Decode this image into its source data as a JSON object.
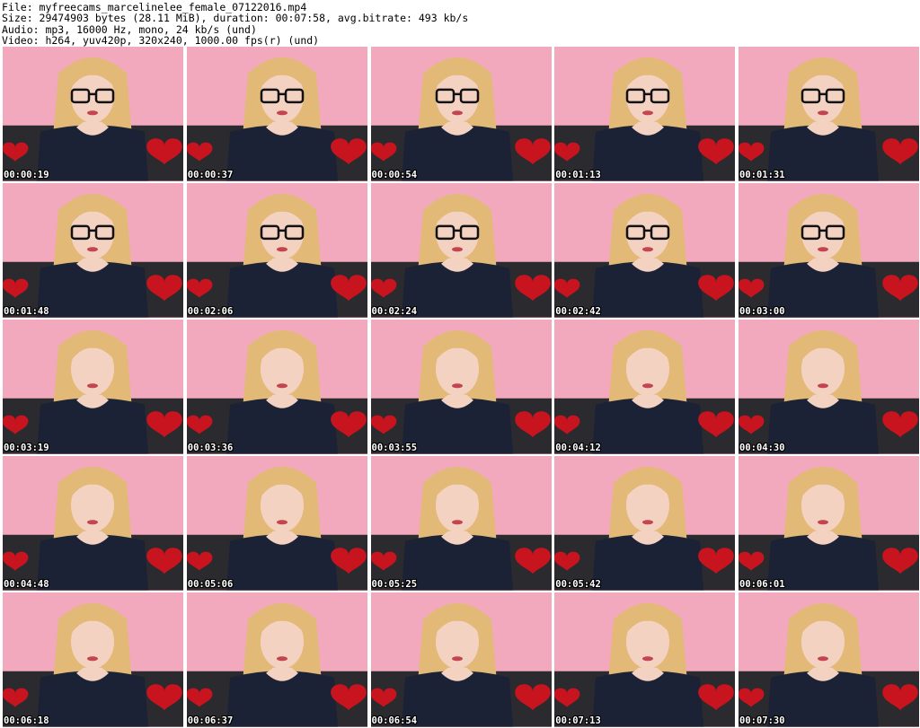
{
  "header": {
    "line1": "File: myfreecams_marcelinelee_female_07122016.mp4",
    "line2": "Size: 29474903 bytes (28.11 MiB), duration: 00:07:58, avg.bitrate: 493 kb/s",
    "line3": "Audio: mp3, 16000 Hz, mono, 24 kb/s (und)",
    "line4": "Video: h264, yuv420p, 320x240, 1000.00 fps(r) (und)"
  },
  "colors": {
    "background": "#f3a9bd",
    "hair": "#e3b978",
    "skin": "#f4d2c2",
    "dress": "#1b2236",
    "couch": "#2b2a2e",
    "heart": "#c8141e"
  },
  "thumbnails": [
    {
      "timestamp": "00:00:19",
      "glasses": true
    },
    {
      "timestamp": "00:00:37",
      "glasses": true
    },
    {
      "timestamp": "00:00:54",
      "glasses": true
    },
    {
      "timestamp": "00:01:13",
      "glasses": true
    },
    {
      "timestamp": "00:01:31",
      "glasses": true
    },
    {
      "timestamp": "00:01:48",
      "glasses": true
    },
    {
      "timestamp": "00:02:06",
      "glasses": true
    },
    {
      "timestamp": "00:02:24",
      "glasses": true
    },
    {
      "timestamp": "00:02:42",
      "glasses": true
    },
    {
      "timestamp": "00:03:00",
      "glasses": true
    },
    {
      "timestamp": "00:03:19",
      "glasses": false
    },
    {
      "timestamp": "00:03:36",
      "glasses": false
    },
    {
      "timestamp": "00:03:55",
      "glasses": false
    },
    {
      "timestamp": "00:04:12",
      "glasses": false
    },
    {
      "timestamp": "00:04:30",
      "glasses": false
    },
    {
      "timestamp": "00:04:48",
      "glasses": false
    },
    {
      "timestamp": "00:05:06",
      "glasses": false
    },
    {
      "timestamp": "00:05:25",
      "glasses": false
    },
    {
      "timestamp": "00:05:42",
      "glasses": false
    },
    {
      "timestamp": "00:06:01",
      "glasses": false
    },
    {
      "timestamp": "00:06:18",
      "glasses": false
    },
    {
      "timestamp": "00:06:37",
      "glasses": false
    },
    {
      "timestamp": "00:06:54",
      "glasses": false
    },
    {
      "timestamp": "00:07:13",
      "glasses": false
    },
    {
      "timestamp": "00:07:30",
      "glasses": false
    }
  ]
}
